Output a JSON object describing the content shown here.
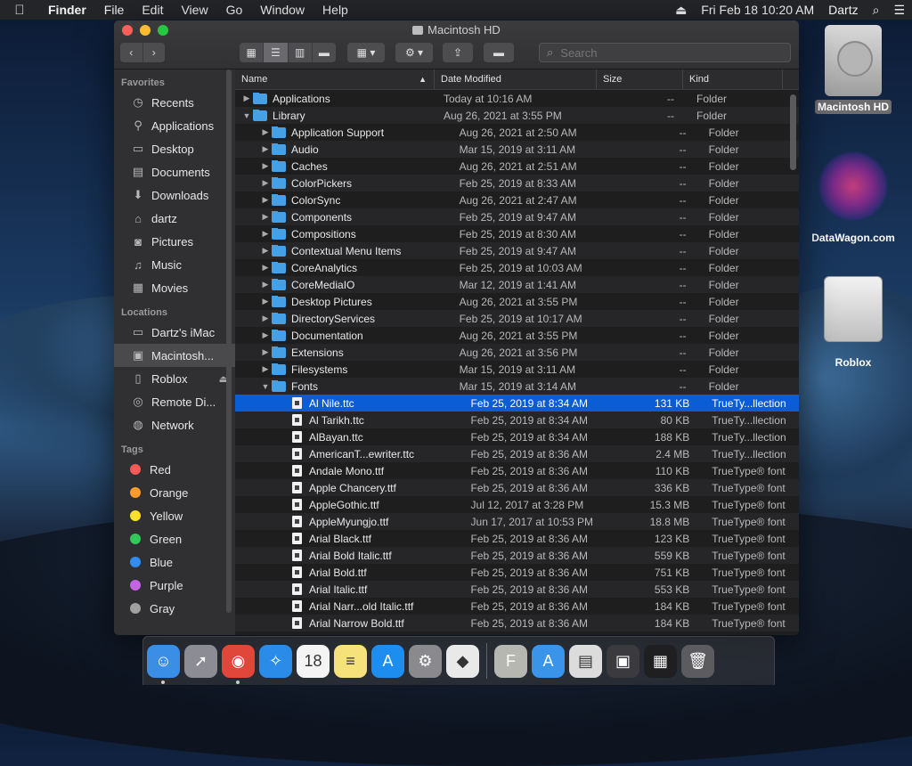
{
  "menubar": {
    "app_name": "Finder",
    "items": [
      "File",
      "Edit",
      "View",
      "Go",
      "Window",
      "Help"
    ],
    "datetime": "Fri Feb 18  10:20 AM",
    "user": "Dartz"
  },
  "window": {
    "title": "Macintosh HD",
    "search_placeholder": "Search"
  },
  "sidebar": {
    "favorites_header": "Favorites",
    "favorites": [
      {
        "label": "Recents",
        "icon": "clock-icon"
      },
      {
        "label": "Applications",
        "icon": "applications-icon"
      },
      {
        "label": "Desktop",
        "icon": "desktop-icon"
      },
      {
        "label": "Documents",
        "icon": "document-icon"
      },
      {
        "label": "Downloads",
        "icon": "download-icon"
      },
      {
        "label": "dartz",
        "icon": "home-icon"
      },
      {
        "label": "Pictures",
        "icon": "camera-icon"
      },
      {
        "label": "Music",
        "icon": "music-icon"
      },
      {
        "label": "Movies",
        "icon": "film-icon"
      }
    ],
    "locations_header": "Locations",
    "locations": [
      {
        "label": "Dartz's iMac",
        "icon": "imac-icon"
      },
      {
        "label": "Macintosh...",
        "icon": "hard-drive-icon"
      },
      {
        "label": "Roblox",
        "icon": "external-drive-icon"
      },
      {
        "label": "Remote Di...",
        "icon": "disc-icon"
      },
      {
        "label": "Network",
        "icon": "globe-icon"
      }
    ],
    "tags_header": "Tags",
    "tags": [
      {
        "label": "Red",
        "color": "#fc5a55"
      },
      {
        "label": "Orange",
        "color": "#fd9c2b"
      },
      {
        "label": "Yellow",
        "color": "#fde12c"
      },
      {
        "label": "Green",
        "color": "#34c759"
      },
      {
        "label": "Blue",
        "color": "#2e8cf2"
      },
      {
        "label": "Purple",
        "color": "#c166e0"
      },
      {
        "label": "Gray",
        "color": "#a0a0a0"
      }
    ]
  },
  "columns": {
    "name": "Name",
    "date": "Date Modified",
    "size": "Size",
    "kind": "Kind"
  },
  "rows": [
    {
      "level": 0,
      "disclosure": "right",
      "type": "folder",
      "name": "Applications",
      "date": "Today at 10:16 AM",
      "size": "--",
      "kind": "Folder"
    },
    {
      "level": 0,
      "disclosure": "down",
      "type": "folder",
      "name": "Library",
      "date": "Aug 26, 2021 at 3:55 PM",
      "size": "--",
      "kind": "Folder"
    },
    {
      "level": 1,
      "disclosure": "right",
      "type": "folder",
      "name": "Application Support",
      "date": "Aug 26, 2021 at 2:50 AM",
      "size": "--",
      "kind": "Folder"
    },
    {
      "level": 1,
      "disclosure": "right",
      "type": "folder",
      "name": "Audio",
      "date": "Mar 15, 2019 at 3:11 AM",
      "size": "--",
      "kind": "Folder"
    },
    {
      "level": 1,
      "disclosure": "right",
      "type": "folder",
      "name": "Caches",
      "date": "Aug 26, 2021 at 2:51 AM",
      "size": "--",
      "kind": "Folder"
    },
    {
      "level": 1,
      "disclosure": "right",
      "type": "folder",
      "name": "ColorPickers",
      "date": "Feb 25, 2019 at 8:33 AM",
      "size": "--",
      "kind": "Folder"
    },
    {
      "level": 1,
      "disclosure": "right",
      "type": "folder",
      "name": "ColorSync",
      "date": "Aug 26, 2021 at 2:47 AM",
      "size": "--",
      "kind": "Folder"
    },
    {
      "level": 1,
      "disclosure": "right",
      "type": "folder",
      "name": "Components",
      "date": "Feb 25, 2019 at 9:47 AM",
      "size": "--",
      "kind": "Folder"
    },
    {
      "level": 1,
      "disclosure": "right",
      "type": "folder",
      "name": "Compositions",
      "date": "Feb 25, 2019 at 8:30 AM",
      "size": "--",
      "kind": "Folder"
    },
    {
      "level": 1,
      "disclosure": "right",
      "type": "folder",
      "name": "Contextual Menu Items",
      "date": "Feb 25, 2019 at 9:47 AM",
      "size": "--",
      "kind": "Folder"
    },
    {
      "level": 1,
      "disclosure": "right",
      "type": "folder",
      "name": "CoreAnalytics",
      "date": "Feb 25, 2019 at 10:03 AM",
      "size": "--",
      "kind": "Folder"
    },
    {
      "level": 1,
      "disclosure": "right",
      "type": "folder",
      "name": "CoreMediaIO",
      "date": "Mar 12, 2019 at 1:41 AM",
      "size": "--",
      "kind": "Folder"
    },
    {
      "level": 1,
      "disclosure": "right",
      "type": "folder",
      "name": "Desktop Pictures",
      "date": "Aug 26, 2021 at 3:55 PM",
      "size": "--",
      "kind": "Folder"
    },
    {
      "level": 1,
      "disclosure": "right",
      "type": "folder",
      "name": "DirectoryServices",
      "date": "Feb 25, 2019 at 10:17 AM",
      "size": "--",
      "kind": "Folder"
    },
    {
      "level": 1,
      "disclosure": "right",
      "type": "folder",
      "name": "Documentation",
      "date": "Aug 26, 2021 at 3:55 PM",
      "size": "--",
      "kind": "Folder"
    },
    {
      "level": 1,
      "disclosure": "right",
      "type": "folder",
      "name": "Extensions",
      "date": "Aug 26, 2021 at 3:56 PM",
      "size": "--",
      "kind": "Folder"
    },
    {
      "level": 1,
      "disclosure": "right",
      "type": "folder",
      "name": "Filesystems",
      "date": "Mar 15, 2019 at 3:11 AM",
      "size": "--",
      "kind": "Folder"
    },
    {
      "level": 1,
      "disclosure": "down",
      "type": "folder",
      "name": "Fonts",
      "date": "Mar 15, 2019 at 3:14 AM",
      "size": "--",
      "kind": "Folder"
    },
    {
      "level": 2,
      "disclosure": "",
      "type": "font",
      "name": "Al Nile.ttc",
      "date": "Feb 25, 2019 at 8:34 AM",
      "size": "131 KB",
      "kind": "TrueTy...llection",
      "selected": true
    },
    {
      "level": 2,
      "disclosure": "",
      "type": "font",
      "name": "Al Tarikh.ttc",
      "date": "Feb 25, 2019 at 8:34 AM",
      "size": "80 KB",
      "kind": "TrueTy...llection"
    },
    {
      "level": 2,
      "disclosure": "",
      "type": "font",
      "name": "AlBayan.ttc",
      "date": "Feb 25, 2019 at 8:34 AM",
      "size": "188 KB",
      "kind": "TrueTy...llection"
    },
    {
      "level": 2,
      "disclosure": "",
      "type": "font",
      "name": "AmericanT...ewriter.ttc",
      "date": "Feb 25, 2019 at 8:36 AM",
      "size": "2.4 MB",
      "kind": "TrueTy...llection"
    },
    {
      "level": 2,
      "disclosure": "",
      "type": "font",
      "name": "Andale Mono.ttf",
      "date": "Feb 25, 2019 at 8:36 AM",
      "size": "110 KB",
      "kind": "TrueType® font"
    },
    {
      "level": 2,
      "disclosure": "",
      "type": "font",
      "name": "Apple Chancery.ttf",
      "date": "Feb 25, 2019 at 8:36 AM",
      "size": "336 KB",
      "kind": "TrueType® font"
    },
    {
      "level": 2,
      "disclosure": "",
      "type": "font",
      "name": "AppleGothic.ttf",
      "date": "Jul 12, 2017 at 3:28 PM",
      "size": "15.3 MB",
      "kind": "TrueType® font"
    },
    {
      "level": 2,
      "disclosure": "",
      "type": "font",
      "name": "AppleMyungjo.ttf",
      "date": "Jun 17, 2017 at 10:53 PM",
      "size": "18.8 MB",
      "kind": "TrueType® font"
    },
    {
      "level": 2,
      "disclosure": "",
      "type": "font",
      "name": "Arial Black.ttf",
      "date": "Feb 25, 2019 at 8:36 AM",
      "size": "123 KB",
      "kind": "TrueType® font"
    },
    {
      "level": 2,
      "disclosure": "",
      "type": "font",
      "name": "Arial Bold Italic.ttf",
      "date": "Feb 25, 2019 at 8:36 AM",
      "size": "559 KB",
      "kind": "TrueType® font"
    },
    {
      "level": 2,
      "disclosure": "",
      "type": "font",
      "name": "Arial Bold.ttf",
      "date": "Feb 25, 2019 at 8:36 AM",
      "size": "751 KB",
      "kind": "TrueType® font"
    },
    {
      "level": 2,
      "disclosure": "",
      "type": "font",
      "name": "Arial Italic.ttf",
      "date": "Feb 25, 2019 at 8:36 AM",
      "size": "553 KB",
      "kind": "TrueType® font"
    },
    {
      "level": 2,
      "disclosure": "",
      "type": "font",
      "name": "Arial Narr...old Italic.ttf",
      "date": "Feb 25, 2019 at 8:36 AM",
      "size": "184 KB",
      "kind": "TrueType® font"
    },
    {
      "level": 2,
      "disclosure": "",
      "type": "font",
      "name": "Arial Narrow Bold.ttf",
      "date": "Feb 25, 2019 at 8:36 AM",
      "size": "184 KB",
      "kind": "TrueType® font"
    }
  ],
  "desktop": {
    "icons": [
      {
        "label": "Macintosh HD"
      },
      {
        "label": "DataWagon.com"
      },
      {
        "label": "Roblox"
      }
    ]
  },
  "dock": {
    "apps": [
      {
        "name": "finder-icon",
        "color": "#3a8ee6",
        "glyph": "☺",
        "running": true
      },
      {
        "name": "launchpad-icon",
        "color": "#8c8c94",
        "glyph": "➚",
        "running": false
      },
      {
        "name": "chrome-icon",
        "color": "#e0463a",
        "glyph": "◉",
        "running": true
      },
      {
        "name": "safari-icon",
        "color": "#2a8be8",
        "glyph": "✧",
        "running": false
      },
      {
        "name": "calendar-icon",
        "color": "#f4f4f4",
        "glyph": "18",
        "running": false
      },
      {
        "name": "notes-icon",
        "color": "#f6e27a",
        "glyph": "≡",
        "running": false
      },
      {
        "name": "app-store-icon",
        "color": "#1d8df0",
        "glyph": "A",
        "running": false
      },
      {
        "name": "system-preferences-icon",
        "color": "#8a8a8e",
        "glyph": "⚙",
        "running": false
      },
      {
        "name": "roblox-icon",
        "color": "#e9e9e9",
        "glyph": "◆",
        "running": false
      },
      {
        "name": "font-book-icon",
        "color": "#b7b7b2",
        "glyph": "F",
        "running": false
      },
      {
        "name": "applications-folder-icon",
        "color": "#3a95ea",
        "glyph": "A",
        "running": false
      },
      {
        "name": "document-stack-icon",
        "color": "#dcdcdc",
        "glyph": "▤",
        "running": false
      },
      {
        "name": "screenshot-icon",
        "color": "#3b3b3f",
        "glyph": "▣",
        "running": false
      },
      {
        "name": "downloads-stack-icon",
        "color": "#1f1f22",
        "glyph": "▦",
        "running": false
      },
      {
        "name": "trash-icon",
        "color": "#5c5c60",
        "glyph": "🗑",
        "running": false
      }
    ]
  }
}
